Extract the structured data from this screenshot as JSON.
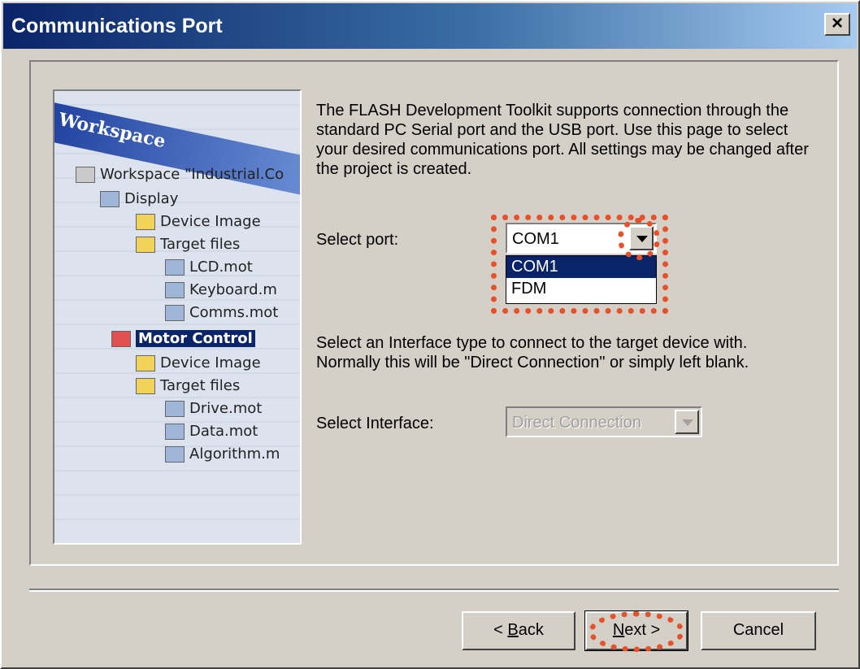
{
  "window": {
    "title": "Communications Port",
    "close_label": "×"
  },
  "picture": {
    "header": "Workspace",
    "items": [
      {
        "label": "Workspace \"Industrial.Co",
        "icon": "workspace-icon"
      },
      {
        "label": "Display",
        "icon": "display-icon"
      },
      {
        "label": "Device Image",
        "icon": "folder-icon"
      },
      {
        "label": "Target files",
        "icon": "folder-icon"
      },
      {
        "label": "LCD.mot",
        "icon": "file-icon"
      },
      {
        "label": "Keyboard.m",
        "icon": "file-icon"
      },
      {
        "label": "Comms.mot",
        "icon": "file-icon"
      },
      {
        "label": "Motor Control",
        "icon": "project-icon"
      },
      {
        "label": "Device Image",
        "icon": "folder-icon"
      },
      {
        "label": "Target files",
        "icon": "folder-icon"
      },
      {
        "label": "Drive.mot",
        "icon": "file-icon"
      },
      {
        "label": "Data.mot",
        "icon": "file-icon"
      },
      {
        "label": "Algorithm.m",
        "icon": "file-icon"
      }
    ]
  },
  "main": {
    "description": "The FLASH Development Toolkit supports connection through the standard PC Serial port and the USB port. Use this page to select your desired communications port. All settings may be changed after the project is created.",
    "port_label": "Select port:",
    "port_value": "COM1",
    "port_options": [
      "COM1",
      "FDM"
    ],
    "interface_description": "Select an Interface type to connect to the target device with. Normally this will be \"Direct Connection\" or simply left blank.",
    "interface_label": "Select Interface:",
    "interface_value": "Direct Connection"
  },
  "buttons": {
    "back_prefix": "< ",
    "back_accel": "B",
    "back_rest": "ack",
    "next_accel": "N",
    "next_rest": "ext >",
    "cancel": "Cancel"
  },
  "colors": {
    "highlight": "#e8502a",
    "title_start": "#0a246a",
    "face": "#d4d0c8"
  }
}
